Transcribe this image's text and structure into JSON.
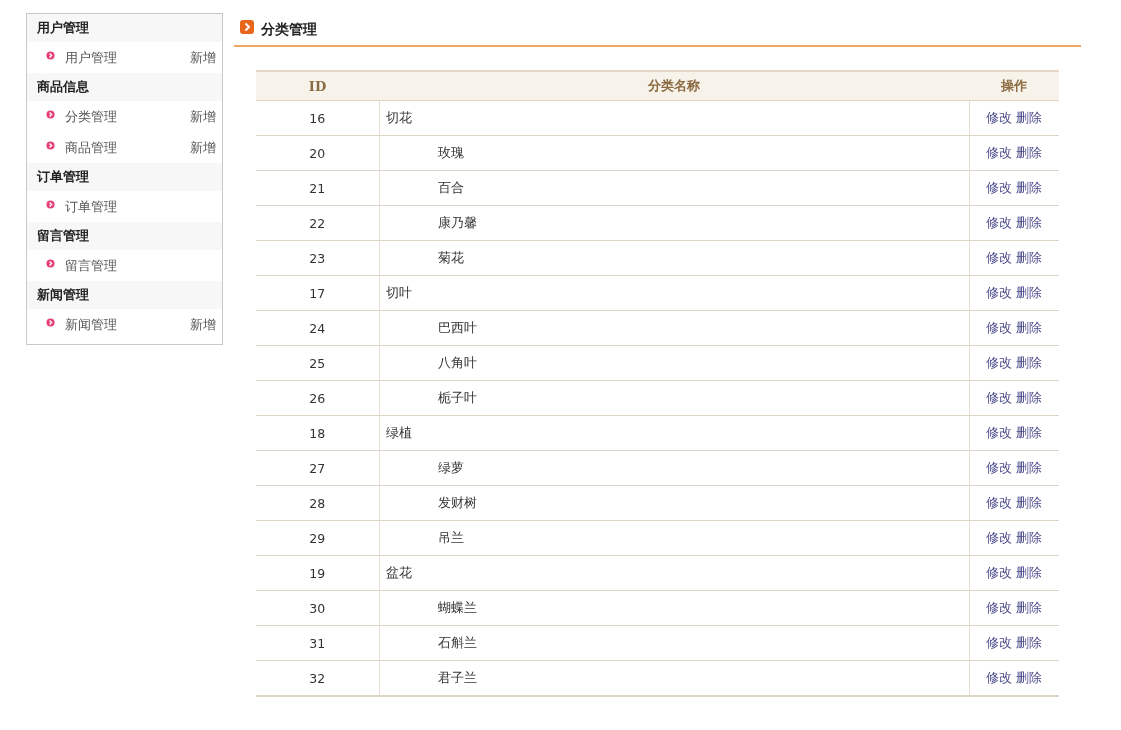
{
  "sidebar": {
    "groups": [
      {
        "title": "用户管理",
        "items": [
          {
            "label": "用户管理",
            "action": "新增"
          }
        ]
      },
      {
        "title": "商品信息",
        "items": [
          {
            "label": "分类管理",
            "action": "新增"
          },
          {
            "label": "商品管理",
            "action": "新增"
          }
        ]
      },
      {
        "title": "订单管理",
        "items": [
          {
            "label": "订单管理"
          }
        ]
      },
      {
        "title": "留言管理",
        "items": [
          {
            "label": "留言管理"
          }
        ]
      },
      {
        "title": "新闻管理",
        "items": [
          {
            "label": "新闻管理",
            "action": "新增"
          }
        ]
      }
    ]
  },
  "page_title": "分类管理",
  "table": {
    "columns": [
      "ID",
      "分类名称",
      "操作"
    ],
    "rows": [
      {
        "id": "16",
        "name": "切花",
        "actions": [
          "修改",
          "删除"
        ],
        "children": [
          {
            "id": "20",
            "name": "玫瑰",
            "actions": [
              "修改",
              "删除"
            ]
          },
          {
            "id": "21",
            "name": "百合",
            "actions": [
              "修改",
              "删除"
            ]
          },
          {
            "id": "22",
            "name": "康乃馨",
            "actions": [
              "修改",
              "删除"
            ]
          },
          {
            "id": "23",
            "name": "菊花",
            "actions": [
              "修改",
              "删除"
            ]
          }
        ]
      },
      {
        "id": "17",
        "name": "切叶",
        "actions": [
          "修改",
          "删除"
        ],
        "children": [
          {
            "id": "24",
            "name": "巴西叶",
            "actions": [
              "修改",
              "删除"
            ]
          },
          {
            "id": "25",
            "name": "八角叶",
            "actions": [
              "修改",
              "删除"
            ]
          },
          {
            "id": "26",
            "name": "栀子叶",
            "actions": [
              "修改",
              "删除"
            ]
          }
        ]
      },
      {
        "id": "18",
        "name": "绿植",
        "actions": [
          "修改",
          "删除"
        ],
        "children": [
          {
            "id": "27",
            "name": "绿萝",
            "actions": [
              "修改",
              "删除"
            ]
          },
          {
            "id": "28",
            "name": "发财树",
            "actions": [
              "修改",
              "删除"
            ]
          },
          {
            "id": "29",
            "name": "吊兰",
            "actions": [
              "修改",
              "删除"
            ]
          }
        ]
      },
      {
        "id": "19",
        "name": "盆花",
        "actions": [
          "修改",
          "删除"
        ],
        "children": [
          {
            "id": "30",
            "name": "蝴蝶兰",
            "actions": [
              "修改",
              "删除"
            ]
          },
          {
            "id": "31",
            "name": "石斛兰",
            "actions": [
              "修改",
              "删除"
            ]
          },
          {
            "id": "32",
            "name": "君子兰",
            "actions": [
              "修改",
              "删除"
            ]
          }
        ]
      }
    ]
  }
}
